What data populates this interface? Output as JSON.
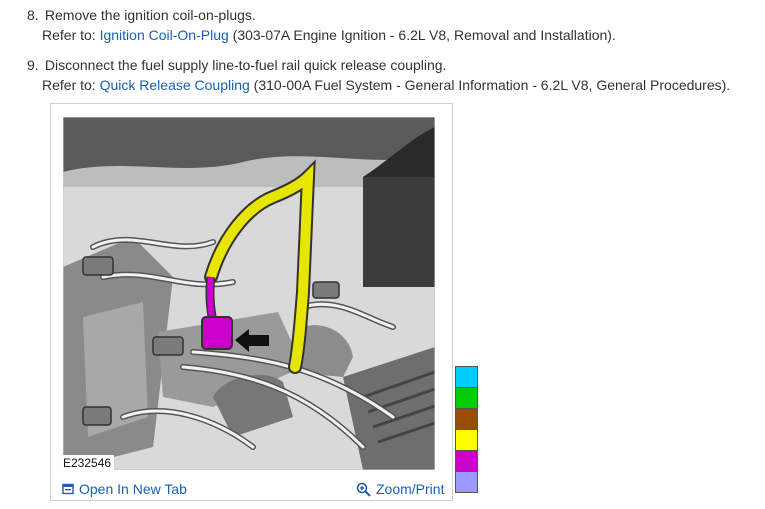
{
  "steps": [
    {
      "number": "8.",
      "text": "Remove the ignition coil-on-plugs.",
      "refer_prefix": "Refer to: ",
      "link": "Ignition Coil-On-Plug",
      "refer_suffix": " (303-07A Engine Ignition - 6.2L V8, Removal and Installation)."
    },
    {
      "number": "9.",
      "text": "Disconnect the fuel supply line-to-fuel rail quick release coupling.",
      "refer_prefix": "Refer to: ",
      "link": "Quick Release Coupling",
      "refer_suffix": " (310-00A Fuel System - General Information - 6.2L V8, General Procedures)."
    }
  ],
  "figure": {
    "id": "E232546",
    "open_label": "Open In New Tab",
    "zoom_label": "Zoom/Print",
    "icons": {
      "open": "open-in-new-tab-icon",
      "zoom": "zoom-in-icon"
    }
  },
  "colors": {
    "link": "#1a5fb4",
    "fuel_line": "#e6e600",
    "coupling": "#cc00cc",
    "legend_swatches": [
      "#00ccff",
      "#00cc00",
      "#994d00",
      "#ffff00",
      "#cc00cc",
      "#9999ff"
    ]
  }
}
